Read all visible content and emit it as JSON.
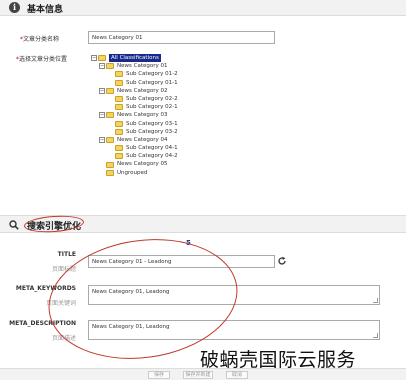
{
  "section_basic": {
    "title": "基本信息",
    "category_name_label": "文章分类名称",
    "category_name_value": "News Category 01",
    "category_position_label": "选择文章分类位置",
    "tree": [
      {
        "label": "All Classifications",
        "level": 0,
        "toggle": "−",
        "selected": true
      },
      {
        "label": "News Category 01",
        "level": 1,
        "toggle": "−"
      },
      {
        "label": "Sub Category 01-2",
        "level": 2
      },
      {
        "label": "Sub Category 01-1",
        "level": 2
      },
      {
        "label": "News Category 02",
        "level": 1,
        "toggle": "−"
      },
      {
        "label": "Sub Category 02-2",
        "level": 2
      },
      {
        "label": "Sub Category 02-1",
        "level": 2
      },
      {
        "label": "News Category 03",
        "level": 1,
        "toggle": "−"
      },
      {
        "label": "Sub Category 03-1",
        "level": 2
      },
      {
        "label": "Sub Category 03-2",
        "level": 2
      },
      {
        "label": "News Category 04",
        "level": 1,
        "toggle": "−"
      },
      {
        "label": "Sub Category 04-1",
        "level": 2
      },
      {
        "label": "Sub Category 04-2",
        "level": 2
      },
      {
        "label": "News Category 05",
        "level": 1
      },
      {
        "label": "Ungrouped",
        "level": 1
      }
    ]
  },
  "section_seo": {
    "title": "搜索引擎优化",
    "count": "5",
    "title_label": "TITLE",
    "title_sublabel": "页面标题",
    "title_value": "News Category 01 - Leadong",
    "keywords_label": "META_KEYWORDS",
    "keywords_sublabel": "页面关键词",
    "keywords_value": "News Category 01, Leadong",
    "description_label": "META_DESCRIPTION",
    "description_sublabel": "页面描述",
    "description_value": "News Category 01, Leadong"
  },
  "footer": {
    "buttons": [
      "保存",
      "保存并新建",
      "取消"
    ]
  },
  "watermark": "破蜗壳国际云服务",
  "colors": {
    "selected_bg": "#1a2a8a",
    "annotation_ellipse": "#c0392b",
    "required_star": "#cc0000"
  }
}
